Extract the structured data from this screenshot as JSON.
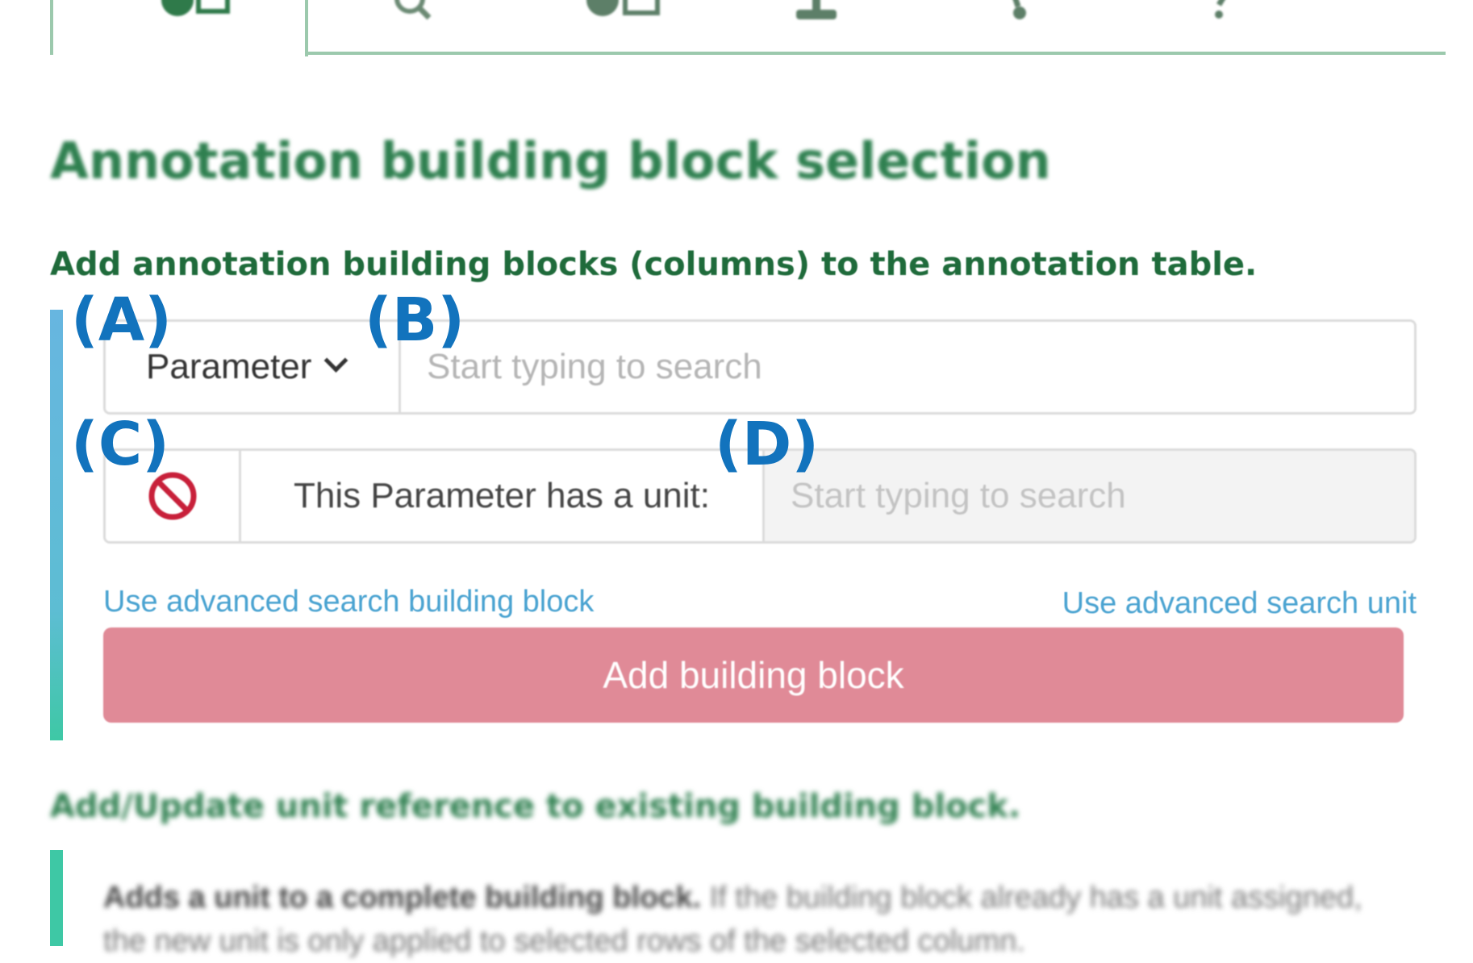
{
  "page_title": "Annotation building block selection",
  "section_subtitle": "Add annotation building blocks (columns) to the annotation table.",
  "panel_labels": {
    "a": "(A)",
    "b": "(B)",
    "c": "(C)",
    "d": "(D)"
  },
  "building_block": {
    "type_selected": "Parameter",
    "search_placeholder": "Start typing to search"
  },
  "unit": {
    "toggle_icon": "prohibited-icon",
    "label": "This Parameter has a unit:",
    "search_placeholder": "Start typing to search"
  },
  "links": {
    "advanced_building_block": "Use advanced search building block",
    "advanced_unit": "Use advanced search unit"
  },
  "add_button_label": "Add building block",
  "unit_section": {
    "title": "Add/Update unit reference to existing building block.",
    "description_bold": "Adds a unit to a complete building block.",
    "description": " If the building block already has a unit assigned, the new unit is only applied to selected rows of the selected column."
  },
  "tabs": [
    {
      "icon": "add-building-block-icon"
    },
    {
      "icon": "search-icon"
    },
    {
      "icon": "add-table-icon"
    },
    {
      "icon": "export-icon"
    },
    {
      "icon": "settings-icon"
    },
    {
      "icon": "help-icon"
    }
  ],
  "colors": {
    "heading_green": "#2f8050",
    "subtitle_green": "#1f6b3b",
    "link_blue": "#4aa3d1",
    "button_disabled_red": "#e08a97",
    "panel_label_blue": "#1273bd",
    "accent_bar_blue": "#67b6e0",
    "accent_bar_teal": "#3ec8a5",
    "prohibited_red": "#c8203a"
  }
}
